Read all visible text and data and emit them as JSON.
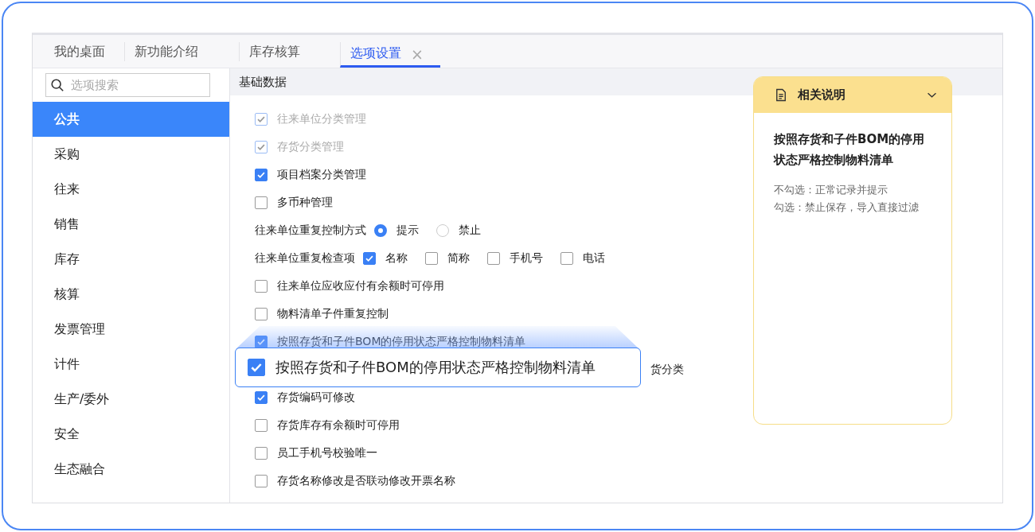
{
  "tabs": [
    {
      "label": "我的桌面",
      "selected": false
    },
    {
      "label": "新功能介绍",
      "selected": false
    },
    {
      "label": "库存核算",
      "selected": false
    },
    {
      "label": "选项设置",
      "selected": true,
      "close": "×"
    }
  ],
  "sidebar": {
    "search": {
      "placeholder": "选项搜索"
    },
    "items": [
      {
        "label": "公共",
        "selected": true
      },
      {
        "label": "采购",
        "selected": false
      },
      {
        "label": "往来",
        "selected": false
      },
      {
        "label": "销售",
        "selected": false
      },
      {
        "label": "库存",
        "selected": false
      },
      {
        "label": "核算",
        "selected": false
      },
      {
        "label": "发票管理",
        "selected": false
      },
      {
        "label": "计件",
        "selected": false
      },
      {
        "label": "生产/委外",
        "selected": false
      },
      {
        "label": "安全",
        "selected": false
      },
      {
        "label": "生态融合",
        "selected": false
      }
    ]
  },
  "section_title": "基础数据",
  "options": [
    {
      "kind": "check",
      "label": "往来单位分类管理",
      "checked": true,
      "disabled": true
    },
    {
      "kind": "check",
      "label": "存货分类管理",
      "checked": true,
      "disabled": true
    },
    {
      "kind": "check",
      "label": "项目档案分类管理",
      "checked": true,
      "disabled": false
    },
    {
      "kind": "check",
      "label": "多币种管理",
      "checked": false,
      "disabled": false
    },
    {
      "kind": "radio",
      "label": "往来单位重复控制方式",
      "choices": [
        {
          "label": "提示",
          "selected": true
        },
        {
          "label": "禁止",
          "selected": false
        }
      ]
    },
    {
      "kind": "multi",
      "label": "往来单位重复检查项",
      "choices": [
        {
          "label": "名称",
          "checked": true
        },
        {
          "label": "简称",
          "checked": false
        },
        {
          "label": "手机号",
          "checked": false
        },
        {
          "label": "电话",
          "checked": false
        }
      ]
    },
    {
      "kind": "check",
      "label": "往来单位应收应付有余额时可停用",
      "checked": false,
      "disabled": false
    },
    {
      "kind": "check",
      "label": "物料清单子件重复控制",
      "checked": false,
      "disabled": false
    },
    {
      "kind": "check",
      "label": "按照存货和子件BOM的停用状态严格控制物料清单",
      "checked": true,
      "disabled": false
    },
    {
      "kind": "tail",
      "label": "货分类"
    },
    {
      "kind": "check",
      "label": "存货编码可修改",
      "checked": true,
      "disabled": false
    },
    {
      "kind": "check",
      "label": "存货库存有余额时可停用",
      "checked": false,
      "disabled": false
    },
    {
      "kind": "check",
      "label": "员工手机号校验唯一",
      "checked": false,
      "disabled": false
    },
    {
      "kind": "check",
      "label": "存货名称修改是否联动修改开票名称",
      "checked": false,
      "disabled": false
    }
  ],
  "callout": {
    "label": "按照存货和子件BOM的停用状态严格控制物料清单",
    "checked": true
  },
  "help_panel": {
    "title": "相关说明",
    "expanded": true,
    "heading": "按照存货和子件BOM的停用状态严格控制物料清单",
    "lines": [
      "不勾选：正常记录并提示",
      "勾选：禁止保存，导入直接过滤"
    ]
  }
}
